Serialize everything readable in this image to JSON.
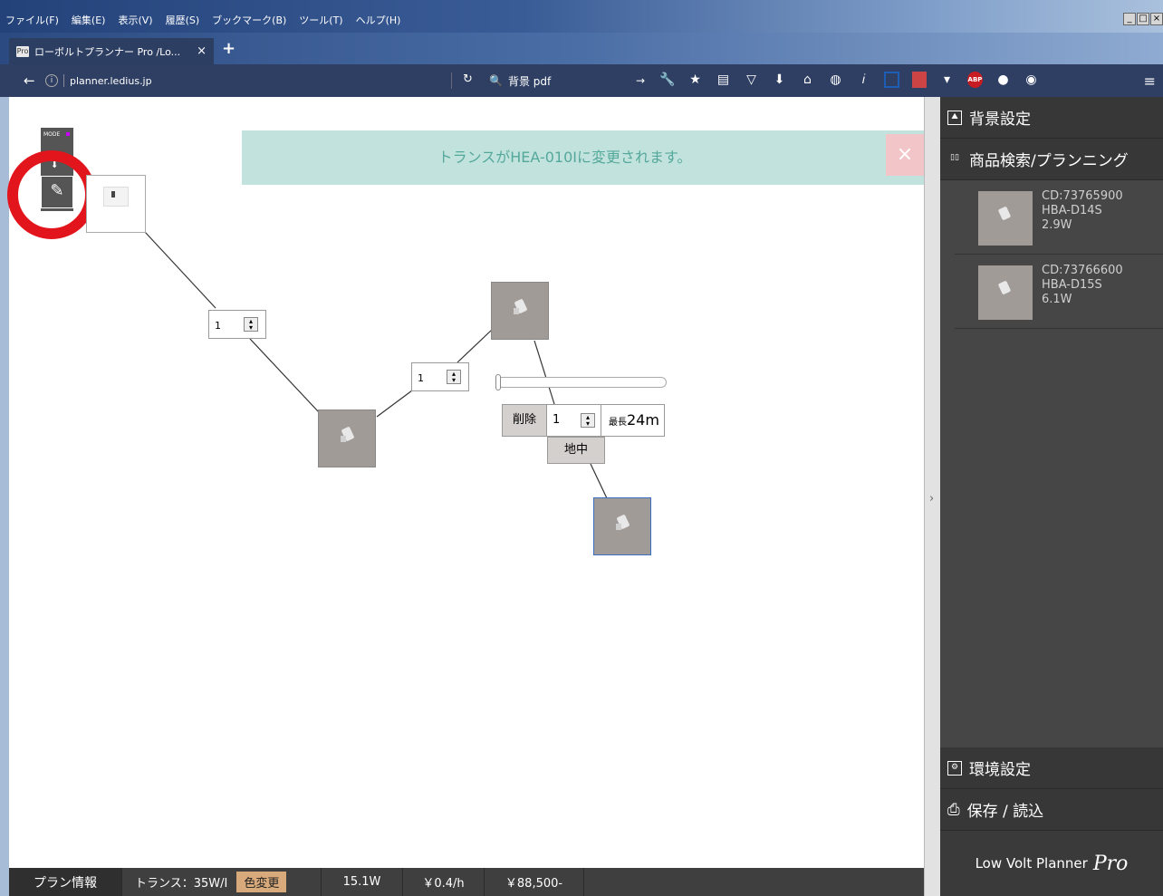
{
  "browser": {
    "menu_items": [
      "ファイル(F)",
      "編集(E)",
      "表示(V)",
      "履歴(S)",
      "ブックマーク(B)",
      "ツール(T)",
      "ヘルプ(H)"
    ],
    "tab_title": "ローボルトプランナー Pro  /Lo...",
    "tab_close": "×",
    "new_tab": "+",
    "url_host": "planner.ledius.jp",
    "search_text": "背景 pdf",
    "favicon_text": "Pro"
  },
  "canvas": {
    "notice_text": "トランスがHEA-010Iに変更されます。",
    "notice_close": "×",
    "mode_label": "MODE",
    "qty_1": "1",
    "qty_2": "1",
    "delete_label": "削除",
    "length_value": "1",
    "max_length_prefix": "最長",
    "max_length_value": "24m",
    "ground_label": "地中"
  },
  "statusbar": {
    "plan_info": "プラン情報",
    "transformer": "トランス：35W/I",
    "color_change": "色変更",
    "wattage": "15.1W",
    "hourly_cost": "￥0.4/h",
    "total_price": "￥88,500-"
  },
  "sidebar": {
    "background_settings": "背景設定",
    "product_search": "商品検索/プランニング",
    "products": [
      {
        "cd": "CD:73765900",
        "model": "HBA-D14S",
        "watt": "2.9W"
      },
      {
        "cd": "CD:73766600",
        "model": "HBA-D15S",
        "watt": "6.1W"
      }
    ],
    "env_settings": "環境設定",
    "save_load": "保存 / 読込",
    "brand": "Low Volt Planner",
    "brand_suffix": "Pro"
  },
  "colors": {
    "notice_bg": "#c2e3dd",
    "notice_text": "#54a89b",
    "highlight": "#e3151c",
    "color_change_bg": "#d8a97b"
  }
}
